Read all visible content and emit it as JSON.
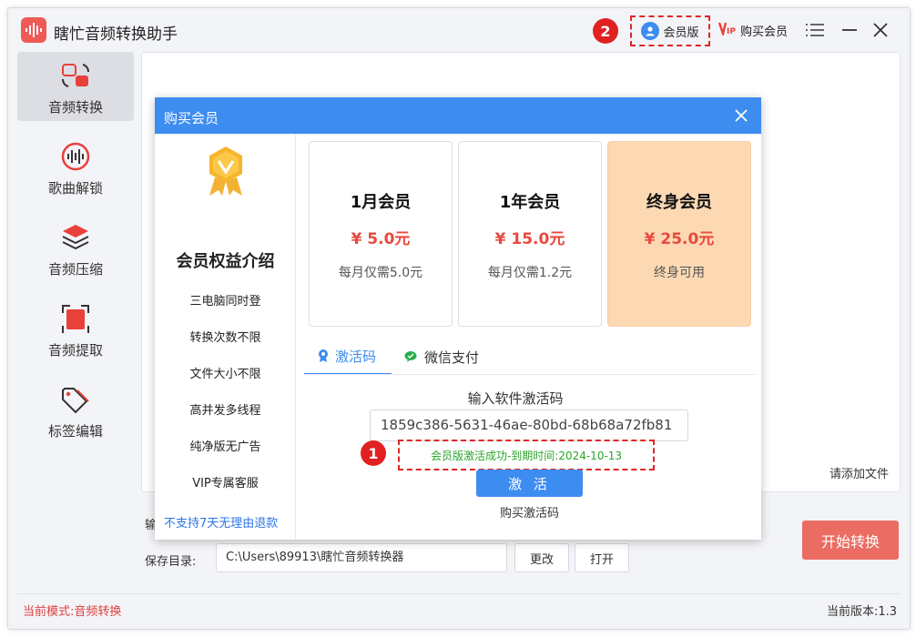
{
  "app": {
    "title": "瞎忙音频转换助手"
  },
  "titlebar": {
    "annotation_2": "2",
    "member_label": "会员版",
    "buy_member_label": "购买会员"
  },
  "sidebar": {
    "items": [
      {
        "label": "音频转换",
        "icon": "audio-convert-icon",
        "active": true
      },
      {
        "label": "歌曲解锁",
        "icon": "unlock-icon",
        "active": false
      },
      {
        "label": "音频压缩",
        "icon": "layers-icon",
        "active": false
      },
      {
        "label": "音频提取",
        "icon": "extract-icon",
        "active": false
      },
      {
        "label": "标签编辑",
        "icon": "tag-icon",
        "active": false
      }
    ]
  },
  "main": {
    "add_file_hint": "请添加文件",
    "output_label_partial": "输",
    "save_dir_label": "保存目录:",
    "save_dir_value": "C:\\Users\\89913\\瞎忙音频转换器",
    "change_button": "更改",
    "open_button": "打开",
    "start_button": "开始转换"
  },
  "status": {
    "mode": "当前模式:音频转换",
    "version": "当前版本:1.3"
  },
  "dialog": {
    "title": "购买会员",
    "benefits_title": "会员权益介绍",
    "benefits": [
      "三电脑同时登",
      "转换次数不限",
      "文件大小不限",
      "高并发多线程",
      "纯净版无广告",
      "VIP专属客服"
    ],
    "refund_note": "不支持7天无理由退款",
    "plans": [
      {
        "name": "1月会员",
        "price": "¥ 5.0元",
        "desc": "每月仅需5.0元",
        "highlighted": false
      },
      {
        "name": "1年会员",
        "price": "¥ 15.0元",
        "desc": "每月仅需1.2元",
        "highlighted": false
      },
      {
        "name": "终身会员",
        "price": "¥ 25.0元",
        "desc": "终身可用",
        "highlighted": true
      }
    ],
    "tabs": [
      {
        "label": "激活码",
        "active": true
      },
      {
        "label": "微信支付",
        "active": false
      }
    ],
    "activation_label": "输入软件激活码",
    "activation_code": "1859c386-5631-46ae-80bd-68b68a72fb81",
    "annotation_1": "1",
    "success_message": "会员版激活成功-到期时间:2024-10-13",
    "activate_button": "激 活",
    "buy_code_link": "购买激活码"
  },
  "colors": {
    "accent_blue": "#3d8cf0",
    "brand_red": "#ee5a55",
    "start_button": "#ea6c62",
    "highlight_plan": "#fcd9b2",
    "success_green": "#2aa52a",
    "annotation_red": "#e12121"
  }
}
